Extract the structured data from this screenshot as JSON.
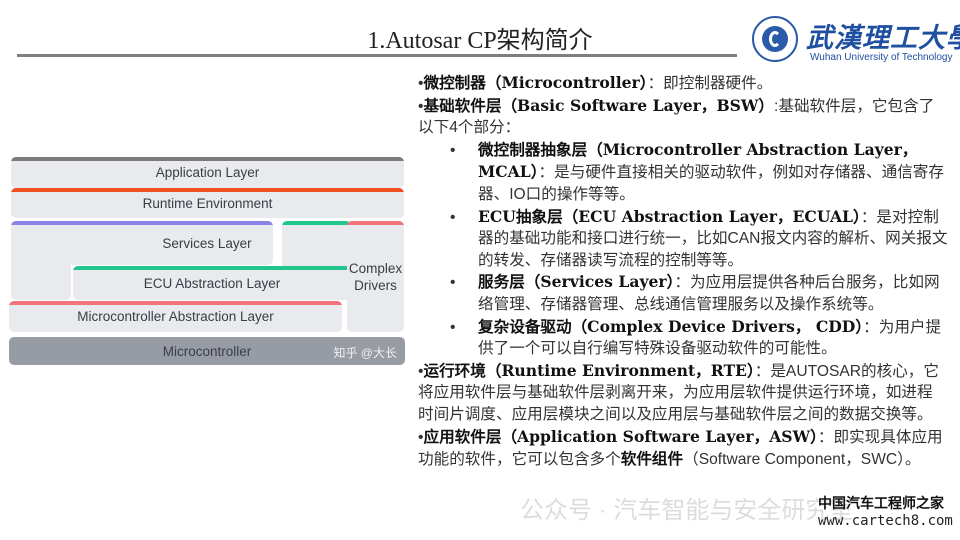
{
  "header": {
    "title": "1.Autosar CP架构简介",
    "logo": {
      "name_cn": "武漢理工大學",
      "name_en": "Wuhan University of Technology",
      "icon": "university-seal-icon"
    }
  },
  "diagram": {
    "layers": {
      "application": {
        "label": "Application Layer",
        "accent": "#7a7a7a"
      },
      "rte": {
        "label": "Runtime Environment",
        "accent": "#f04e23"
      },
      "services": {
        "label": "Services Layer",
        "accent": "#8b84e8"
      },
      "ecu": {
        "label": "ECU Abstraction Layer",
        "accent": "#22c58b"
      },
      "complex_line1": "Complex",
      "complex_line2": "Drivers",
      "complex_accent": "#f07478",
      "mcal": {
        "label": "Microcontroller Abstraction Layer",
        "accent": "#f07478"
      },
      "mcu": {
        "label": "Microcontroller"
      }
    },
    "watermark": "知乎 @大长"
  },
  "content": {
    "p1": {
      "bullet": "•",
      "term": "微控制器（Microcontroller）",
      "text": "：即控制器硬件。"
    },
    "p2": {
      "bullet": "•",
      "term": "基础软件层（Basic Software Layer，BSW）",
      "text": ":基础软件层，它包含了以下4个部分："
    },
    "subs": [
      {
        "bullet": "•",
        "term": "微控制器抽象层（Microcontroller Abstraction Layer， MCAL）",
        "text": "：是与硬件直接相关的驱动软件，例如对存储器、通信寄存器、IO口的操作等等。"
      },
      {
        "bullet": "•",
        "term": "ECU抽象层（ECU Abstraction Layer，ECUAL）",
        "text": "：是对控制器的基础功能和接口进行统一，比如CAN报文内容的解析、网关报文的转发、存储器读写流程的控制等等。"
      },
      {
        "bullet": "•",
        "term": "服务层（Services Layer）",
        "text": "：为应用层提供各种后台服务，比如网络管理、存储器管理、总线通信管理服务以及操作系统等。"
      },
      {
        "bullet": "•",
        "term": "复杂设备驱动（Complex Device Drivers， CDD）",
        "text": "：为用户提供了一个可以自行编写特殊设备驱动软件的可能性。"
      }
    ],
    "p3": {
      "bullet": "•",
      "term": "运行环境（Runtime Environment，RTE）",
      "text": "：是AUTOSAR的核心，它将应用软件层与基础软件层剥离开来，为应用层软件提供运行环境，如进程时间片调度、应用层模块之间以及应用层与基础软件层之间的数据交换等。"
    },
    "p4": {
      "bullet": "•",
      "term": "应用软件层（Application Software Layer，ASW）",
      "text": "：即实现具体应用功能的软件，它可以包含多个",
      "term2": "软件组件",
      "text2": "（Software Component，SWC）。"
    }
  },
  "watermarks": {
    "wechat": "公众号 · 汽车智能与安全研究室",
    "site_cn": "中国汽车工程师之家",
    "site_url": "www.cartech8.com"
  }
}
